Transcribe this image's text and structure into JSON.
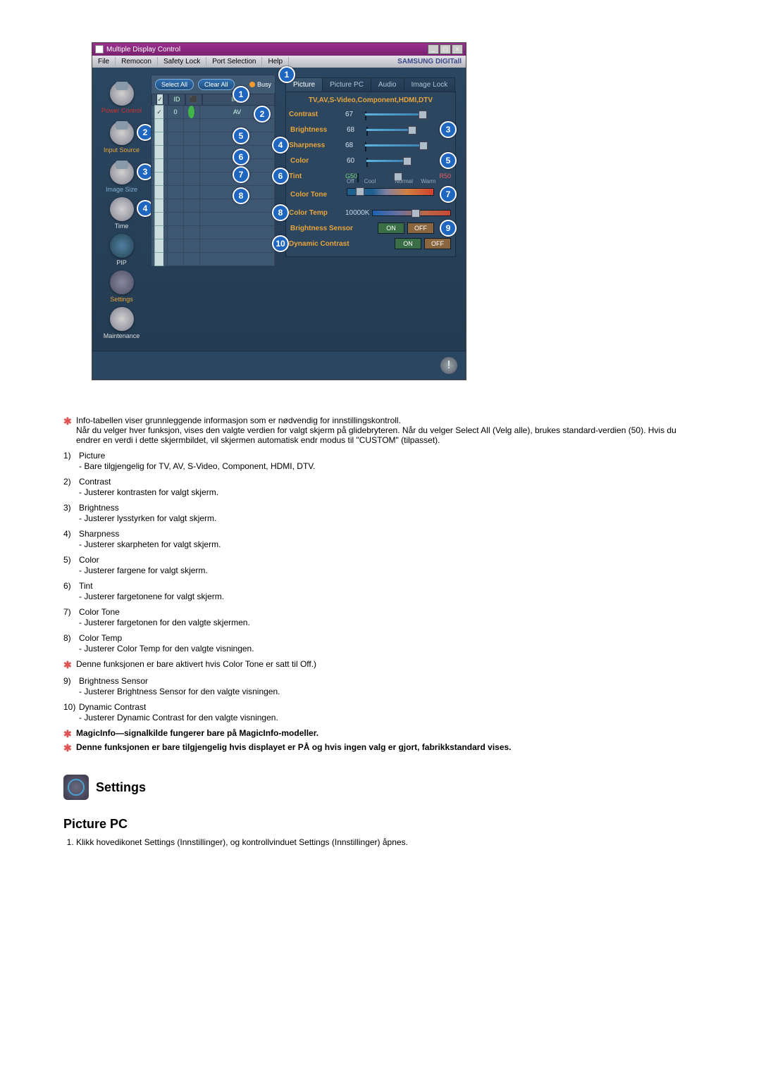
{
  "app": {
    "title": "Multiple Display Control",
    "brand": "SAMSUNG DIGITall",
    "menu": [
      "File",
      "Remocon",
      "Safety Lock",
      "Port Selection",
      "Help"
    ]
  },
  "win_controls": {
    "min": "_",
    "max": "▢",
    "close": "x"
  },
  "sidebar": {
    "items": [
      {
        "label": "Power Control",
        "color": "lbl-red"
      },
      {
        "label": "Input Source",
        "color": "lbl-orange"
      },
      {
        "label": "Image Size",
        "color": "lbl-blue"
      },
      {
        "label": "Time",
        "color": "lbl-white"
      },
      {
        "label": "PIP",
        "color": "lbl-white"
      },
      {
        "label": "Settings",
        "color": "lbl-orange"
      },
      {
        "label": "Maintenance",
        "color": "lbl-white"
      }
    ]
  },
  "list": {
    "select_all": "Select All",
    "clear_all": "Clear All",
    "busy": "Busy",
    "cols": {
      "id": "ID",
      "input": "Input"
    },
    "rows": [
      {
        "chk": true,
        "id": "0",
        "status": "on",
        "input": "AV"
      },
      {
        "chk": false
      },
      {
        "chk": false
      },
      {
        "chk": false
      },
      {
        "chk": false
      },
      {
        "chk": false
      },
      {
        "chk": false
      },
      {
        "chk": false
      },
      {
        "chk": false
      },
      {
        "chk": false
      },
      {
        "chk": false
      },
      {
        "chk": false
      }
    ]
  },
  "panel": {
    "tabs": [
      "Picture",
      "Picture PC",
      "Audio",
      "Image Lock"
    ],
    "active_tab": 0,
    "signal_text": "TV,AV,S-Video,Component,HDMI,DTV",
    "sliders": {
      "contrast": {
        "name": "Contrast",
        "value": 67
      },
      "brightness": {
        "name": "Brightness",
        "value": 68
      },
      "sharpness": {
        "name": "Sharpness",
        "value": 68
      },
      "color": {
        "name": "Color",
        "value": 60
      },
      "tint": {
        "name": "Tint",
        "left": "G50",
        "right": "R50"
      }
    },
    "color_tone": {
      "name": "Color Tone",
      "labels": [
        "Off",
        "Cool",
        "Normal",
        "Warm"
      ]
    },
    "color_temp": {
      "name": "Color Temp",
      "value": "10000K"
    },
    "bright_sensor": {
      "name": "Brightness Sensor",
      "on": "ON",
      "off": "OFF"
    },
    "dyn_contrast": {
      "name": "Dynamic Contrast",
      "on": "ON",
      "off": "OFF"
    }
  },
  "badges": {
    "list": [
      "1",
      "2",
      "3",
      "4",
      "5",
      "6",
      "7",
      "8",
      "9",
      "10"
    ],
    "sidebar": [
      "2",
      "3",
      "4"
    ],
    "listcol": [
      "1",
      "5",
      "6",
      "7",
      "8"
    ],
    "panel": [
      "2",
      "3",
      "4",
      "5",
      "6",
      "7",
      "8",
      "9"
    ]
  },
  "doc": {
    "star_notes": [
      "Info-tabellen viser grunnleggende informasjon som er nødvendig for innstillingskontroll.",
      "Når du velger hver funksjon, vises den valgte verdien for valgt skjerm på glidebryteren. Når du velger Select All (Velg alle), brukes standard-verdien (50). Hvis du endrer en verdi i dette skjermbildet, vil skjermen automatisk endr modus til \"CUSTOM\" (tilpasset)."
    ],
    "items": [
      {
        "n": "1)",
        "h": "Picture",
        "d": "- Bare tilgjengelig for TV, AV, S-Video, Component, HDMI, DTV."
      },
      {
        "n": "2)",
        "h": "Contrast",
        "d": "- Justerer kontrasten for valgt skjerm."
      },
      {
        "n": "3)",
        "h": "Brightness",
        "d": "- Justerer lysstyrken for valgt skjerm."
      },
      {
        "n": "4)",
        "h": "Sharpness",
        "d": "- Justerer skarpheten for valgt skjerm."
      },
      {
        "n": "5)",
        "h": "Color",
        "d": "- Justerer fargene for valgt skjerm."
      },
      {
        "n": "6)",
        "h": "Tint",
        "d": "- Justerer fargetonene for valgt skjerm."
      },
      {
        "n": "7)",
        "h": "Color Tone",
        "d": "- Justerer fargetonen for den valgte skjermen."
      },
      {
        "n": "8)",
        "h": "Color Temp",
        "d": "- Justerer Color Temp for den valgte visningen."
      }
    ],
    "mid_star": "Denne funksjonen er bare aktivert hvis Color Tone er satt til Off.)",
    "items2": [
      {
        "n": "9)",
        "h": "Brightness Sensor",
        "d": "- Justerer Brightness Sensor for den valgte visningen."
      },
      {
        "n": "10)",
        "h": "Dynamic Contrast",
        "d": "- Justerer Dynamic Contrast for den valgte visningen."
      }
    ],
    "bold_stars": [
      "MagicInfo—signalkilde fungerer bare på MagicInfo-modeller.",
      "Denne funksjonen er bare tilgjengelig hvis displayet er PÅ og hvis ingen valg er gjort, fabrikkstandard vises."
    ],
    "settings_heading": "Settings",
    "sub_heading": "Picture PC",
    "ol_item": "Klikk hovedikonet Settings (Innstillinger), og kontrollvinduet Settings (Innstillinger) åpnes."
  }
}
